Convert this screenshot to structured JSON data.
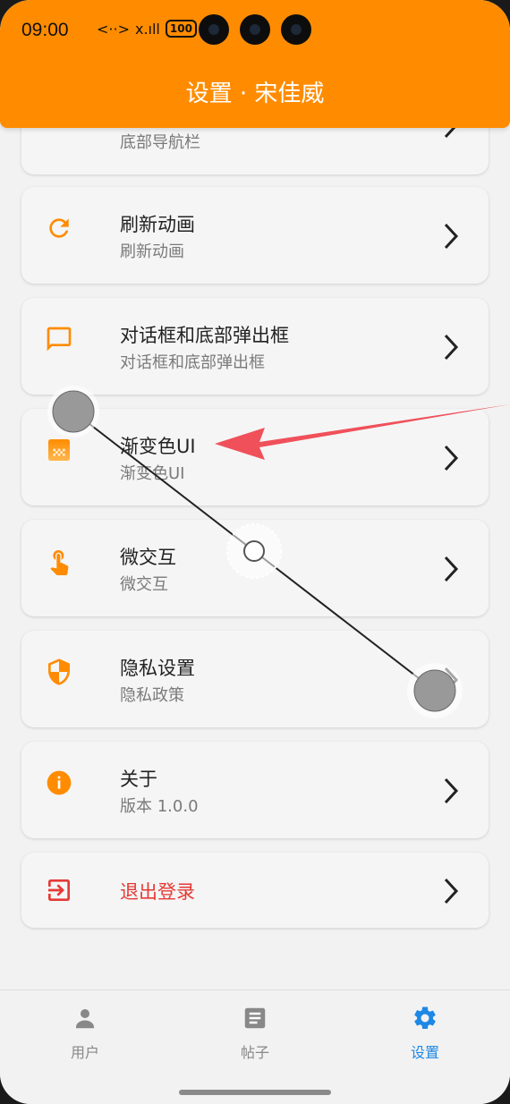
{
  "status_bar": {
    "time": "09:00",
    "network": "<··>",
    "signal": "x.ıll",
    "battery": "100"
  },
  "header": {
    "title": "设置 · 宋佳威"
  },
  "settings": [
    {
      "title": "",
      "subtitle": "底部导航栏",
      "icon": "chevron-icon"
    },
    {
      "title": "刷新动画",
      "subtitle": "刷新动画",
      "icon": "refresh-icon"
    },
    {
      "title": "对话框和底部弹出框",
      "subtitle": "对话框和底部弹出框",
      "icon": "chat-bubble-icon"
    },
    {
      "title": "渐变色UI",
      "subtitle": "渐变色UI",
      "icon": "gradient-icon"
    },
    {
      "title": "微交互",
      "subtitle": "微交互",
      "icon": "touch-icon"
    },
    {
      "title": "隐私设置",
      "subtitle": "隐私政策",
      "icon": "shield-icon"
    },
    {
      "title": "关于",
      "subtitle": "版本 1.0.0",
      "icon": "info-icon"
    },
    {
      "title": "退出登录",
      "icon": "logout-icon"
    }
  ],
  "bottom_nav": [
    {
      "label": "用户",
      "icon": "person-icon",
      "active": false
    },
    {
      "label": "帖子",
      "icon": "article-icon",
      "active": false
    },
    {
      "label": "设置",
      "icon": "gear-icon",
      "active": true
    }
  ],
  "colors": {
    "accent": "#ff8c00",
    "active_tab": "#1e88e5",
    "logout": "#e53935",
    "arrow_annotation": "#f0505a"
  }
}
